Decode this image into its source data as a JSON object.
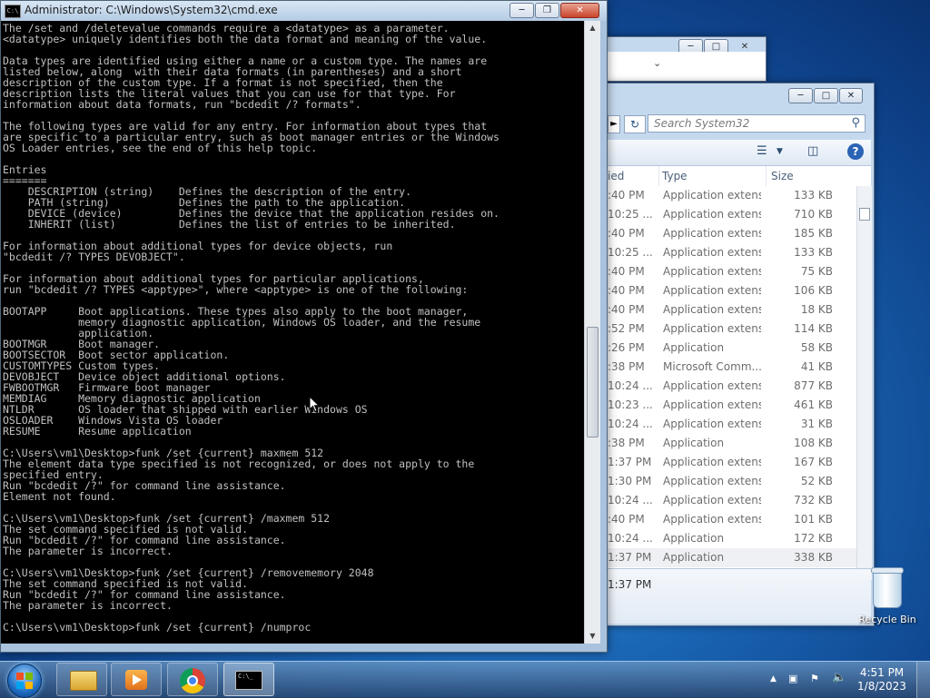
{
  "cmd": {
    "title": "Administrator: C:\\Windows\\System32\\cmd.exe",
    "icon_text": "C:\\",
    "text": "The /set and /deletevalue commands require a <datatype> as a parameter.\n<datatype> uniquely identifies both the data format and meaning of the value.\n\nData types are identified using either a name or a custom type. The names are\nlisted below, along  with their data formats (in parentheses) and a short\ndescription of the custom type. If a format is not specified, then the\ndescription lists the literal values that you can use for that type. For\ninformation about data formats, run \"bcdedit /? formats\".\n\nThe following types are valid for any entry. For information about types that\nare specific to a particular entry, such as boot manager entries or the Windows\nOS Loader entries, see the end of this help topic.\n\nEntries\n=======\n    DESCRIPTION (string)    Defines the description of the entry.\n    PATH (string)           Defines the path to the application.\n    DEVICE (device)         Defines the device that the application resides on.\n    INHERIT (list)          Defines the list of entries to be inherited.\n\nFor information about additional types for device objects, run\n\"bcdedit /? TYPES DEVOBJECT\".\n\nFor information about additional types for particular applications,\nrun \"bcdedit /? TYPES <apptype>\", where <apptype> is one of the following:\n\nBOOTAPP     Boot applications. These types also apply to the boot manager,\n            memory diagnostic application, Windows OS loader, and the resume\n            application.\nBOOTMGR     Boot manager.\nBOOTSECTOR  Boot sector application.\nCUSTOMTYPES Custom types.\nDEVOBJECT   Device object additional options.\nFWBOOTMGR   Firmware boot manager\nMEMDIAG     Memory diagnostic application\nNTLDR       OS loader that shipped with earlier Windows OS\nOSLOADER    Windows Vista OS loader\nRESUME      Resume application\n\nC:\\Users\\vm1\\Desktop>funk /set {current} maxmem 512\nThe element data type specified is not recognized, or does not apply to the\nspecified entry.\nRun \"bcdedit /?\" for command line assistance.\nElement not found.\n\nC:\\Users\\vm1\\Desktop>funk /set {current} /maxmem 512\nThe set command specified is not valid.\nRun \"bcdedit /?\" for command line assistance.\nThe parameter is incorrect.\n\nC:\\Users\\vm1\\Desktop>funk /set {current} /removememory 2048\nThe set command specified is not valid.\nRun \"bcdedit /?\" for command line assistance.\nThe parameter is incorrect.\n\nC:\\Users\\vm1\\Desktop>funk /set {current} /numproc"
  },
  "explorer": {
    "search_placeholder": "Search System32",
    "columns": {
      "date": "ied",
      "type": "Type",
      "size": "Size"
    },
    "rows": [
      {
        "date": ":40 PM",
        "type": "Application extens...",
        "size": "133 KB"
      },
      {
        "date": "10:25 ...",
        "type": "Application extens...",
        "size": "710 KB"
      },
      {
        "date": ":40 PM",
        "type": "Application extens...",
        "size": "185 KB"
      },
      {
        "date": "10:25 ...",
        "type": "Application extens...",
        "size": "133 KB"
      },
      {
        "date": ":40 PM",
        "type": "Application extens...",
        "size": "75 KB"
      },
      {
        "date": ":40 PM",
        "type": "Application extens...",
        "size": "106 KB"
      },
      {
        "date": ":40 PM",
        "type": "Application extens...",
        "size": "18 KB"
      },
      {
        "date": ":52 PM",
        "type": "Application extens...",
        "size": "114 KB"
      },
      {
        "date": ":26 PM",
        "type": "Application",
        "size": "58 KB"
      },
      {
        "date": ":38 PM",
        "type": "Microsoft Comm...",
        "size": "41 KB"
      },
      {
        "date": "10:24 ...",
        "type": "Application extens...",
        "size": "877 KB"
      },
      {
        "date": "10:23 ...",
        "type": "Application extens...",
        "size": "461 KB"
      },
      {
        "date": "10:24 ...",
        "type": "Application extens...",
        "size": "31 KB"
      },
      {
        "date": ":38 PM",
        "type": "Application",
        "size": "108 KB"
      },
      {
        "date": "1:37 PM",
        "type": "Application extens...",
        "size": "167 KB"
      },
      {
        "date": "1:30 PM",
        "type": "Application extens...",
        "size": "52 KB"
      },
      {
        "date": "10:24 ...",
        "type": "Application extens...",
        "size": "732 KB"
      },
      {
        "date": ":40 PM",
        "type": "Application extens...",
        "size": "101 KB"
      },
      {
        "date": "10:24 ...",
        "type": "Application",
        "size": "172 KB"
      },
      {
        "date": "1:37 PM",
        "type": "Application",
        "size": "338 KB",
        "selected": true
      }
    ],
    "detail_time": "1:37 PM"
  },
  "desktop": {
    "recycle_bin_label": "Recycle Bin"
  },
  "taskbar": {
    "time": "4:51 PM",
    "date": "1/8/2023",
    "pinned": [
      "windows-explorer",
      "media-player",
      "google-chrome",
      "command-prompt"
    ]
  },
  "colors": {
    "console_bg": "#000000",
    "console_fg": "#c0c0c0",
    "selected_row": "#eef0f3"
  }
}
